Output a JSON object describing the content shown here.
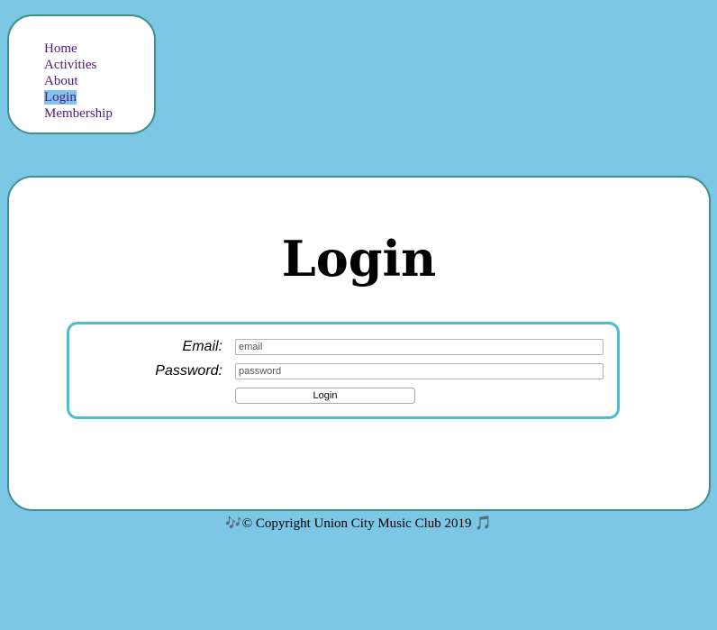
{
  "nav": {
    "items": [
      {
        "label": "Home"
      },
      {
        "label": "Activities"
      },
      {
        "label": "About"
      },
      {
        "label": "Login",
        "active": true
      },
      {
        "label": "Membership"
      }
    ]
  },
  "page": {
    "title": "Login"
  },
  "form": {
    "email_label": "Email:",
    "email_placeholder": "email",
    "password_label": "Password:",
    "password_placeholder": "password",
    "submit_label": "Login"
  },
  "footer": {
    "left_icon": "🎶",
    "text": "© Copyright Union City Music Club 2019",
    "right_icon": "🎵"
  },
  "colors": {
    "background": "#7cc6e6",
    "panel_border": "#3f8f8a",
    "form_border": "#46bfcf",
    "nav_link": "#4b1a7d",
    "active_highlight": "#86c3eb"
  }
}
